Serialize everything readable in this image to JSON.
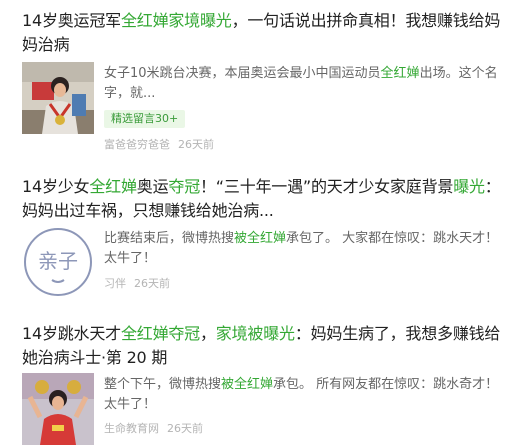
{
  "colors": {
    "highlight": "#34a834",
    "title": "#222222",
    "snippet": "#666666",
    "meta": "#b4b4b4",
    "badge_bg": "#eaf7e6"
  },
  "results": [
    {
      "title_parts": [
        {
          "text": "14岁奥运冠军",
          "hl": false
        },
        {
          "text": "全红婵家境曝光",
          "hl": true
        },
        {
          "text": "，一句话说出拼命真相！我想赚钱给妈妈治病",
          "hl": false
        }
      ],
      "thumbnail_icon": "athlete-photo-icon",
      "snippet_parts": [
        {
          "text": "女子10米跳台决赛，本届奥运会最小中国运动员",
          "hl": false
        },
        {
          "text": "全红婵",
          "hl": true
        },
        {
          "text": "出场。这个名字，就...",
          "hl": false
        }
      ],
      "badge": "精选留言30+",
      "source": "富爸爸穷爸爸",
      "time": "26天前"
    },
    {
      "title_parts": [
        {
          "text": "14岁少女",
          "hl": false
        },
        {
          "text": "全红婵",
          "hl": true
        },
        {
          "text": "奥运",
          "hl": false
        },
        {
          "text": "夺冠",
          "hl": true
        },
        {
          "text": "！“三十年一遇”的天才少女家庭背景",
          "hl": false
        },
        {
          "text": "曝光",
          "hl": true
        },
        {
          "text": "：妈妈出过车祸，只想赚钱给她治病...",
          "hl": false
        }
      ],
      "thumbnail_icon": "qinzi-logo-icon",
      "thumbnail_text": "亲子",
      "snippet_parts": [
        {
          "text": "比赛结束后，微博热搜",
          "hl": false
        },
        {
          "text": "被全红婵",
          "hl": true
        },
        {
          "text": "承包了。 大家都在惊叹：跳水天才！ 太牛了！",
          "hl": false
        }
      ],
      "source": "习伴",
      "time": "26天前"
    },
    {
      "title_parts": [
        {
          "text": "14岁跳水天才",
          "hl": false
        },
        {
          "text": "全红婵夺冠",
          "hl": true
        },
        {
          "text": "，",
          "hl": false
        },
        {
          "text": "家境被曝光",
          "hl": true
        },
        {
          "text": "：妈妈生病了，我想多赚钱给她治病斗士·第 20 期",
          "hl": false
        }
      ],
      "thumbnail_icon": "diver-photo-icon",
      "snippet_parts": [
        {
          "text": "整个下午，微博热搜",
          "hl": false
        },
        {
          "text": "被全红婵",
          "hl": true
        },
        {
          "text": "承包。 所有网友都在惊叹：跳水奇才！ 太牛了！",
          "hl": false
        }
      ],
      "source": "生命教育网",
      "time": "26天前"
    }
  ]
}
